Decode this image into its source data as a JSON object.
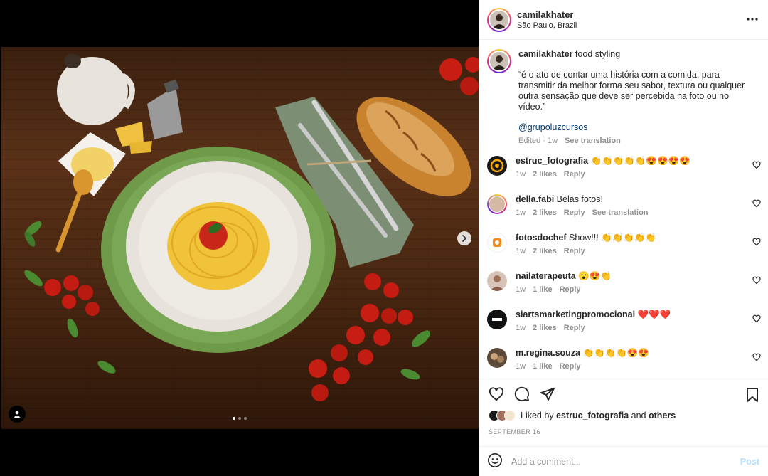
{
  "post": {
    "author": "camilakhater",
    "location": "São Paulo, Brazil",
    "caption": {
      "author": "camilakhater",
      "first_line": "food styling",
      "quote": "“é o ato de contar uma história com a comida, para transmitir da melhor forma seu sabor, textura ou qualquer outra sensação que deve ser percebida na foto ou no vídeo.”",
      "mention": "@grupoluzcursos",
      "edited": "Edited · 1w",
      "see_translation": "See translation"
    },
    "comments": [
      {
        "user": "estruc_fotografia",
        "text": "👏👏👏👏👏😍😍😍😍",
        "time": "1w",
        "likes": "2 likes",
        "reply": "Reply",
        "avatar_color": "#1a1a1a",
        "accent": "#f7a600"
      },
      {
        "user": "della.fabi",
        "text": "Belas fotos!",
        "time": "1w",
        "likes": "2 likes",
        "reply": "Reply",
        "see_translation": "See translation",
        "avatar_color": "#d6b9a5",
        "accent": "#4a8a4f"
      },
      {
        "user": "fotosdochef",
        "text": "Show!!! 👏👏👏👏👏",
        "time": "1w",
        "likes": "2 likes",
        "reply": "Reply",
        "avatar_color": "#ffffff",
        "accent": "#f28a1e"
      },
      {
        "user": "nailaterapeuta",
        "text": "😮😍👏",
        "time": "1w",
        "likes": "1 like",
        "reply": "Reply",
        "avatar_color": "#d8c3b8",
        "accent": "#a0705a"
      },
      {
        "user": "siartsmarketingpromocional",
        "text": "❤️❤️❤️",
        "time": "1w",
        "likes": "2 likes",
        "reply": "Reply",
        "avatar_color": "#111111",
        "accent": "#ffffff"
      },
      {
        "user": "m.regina.souza",
        "text": "👏👏👏👏😍😍",
        "time": "1w",
        "likes": "1 like",
        "reply": "Reply",
        "avatar_color": "#5b4a3a",
        "accent": "#c9a27a"
      }
    ],
    "liked_by_prefix": "Liked by",
    "liked_by_user": "estruc_fotografia",
    "liked_by_and": "and",
    "liked_by_others": "others",
    "date": "SEPTEMBER 16",
    "add_comment_placeholder": "Add a comment...",
    "post_button": "Post"
  },
  "icons": {
    "more": "more-options-icon",
    "like": "heart-icon",
    "comment": "comment-icon",
    "share": "send-icon",
    "save": "bookmark-icon",
    "emoji": "emoji-icon",
    "next": "chevron-right-icon",
    "user_tag": "person-icon"
  },
  "colors": {
    "link": "#00376b",
    "muted": "#8e8e8e",
    "post_disabled": "#b2dffc"
  }
}
